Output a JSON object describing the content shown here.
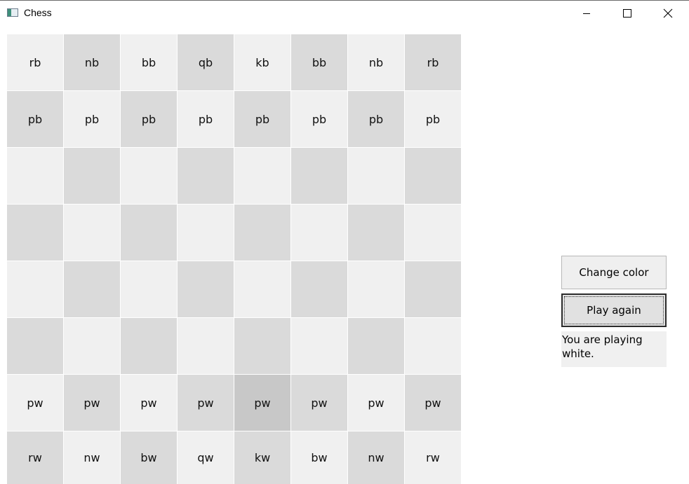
{
  "window": {
    "title": "Chess",
    "icon": "window-app-icon",
    "controls": [
      "minimize-icon",
      "maximize-icon",
      "close-icon"
    ]
  },
  "board": {
    "rows": [
      [
        "rb",
        "nb",
        "bb",
        "qb",
        "kb",
        "bb",
        "nb",
        "rb"
      ],
      [
        "pb",
        "pb",
        "pb",
        "pb",
        "pb",
        "pb",
        "pb",
        "pb"
      ],
      [
        "",
        "",
        "",
        "",
        "",
        "",
        "",
        ""
      ],
      [
        "",
        "",
        "",
        "",
        "",
        "",
        "",
        ""
      ],
      [
        "",
        "",
        "",
        "",
        "",
        "",
        "",
        ""
      ],
      [
        "",
        "",
        "",
        "",
        "",
        "",
        "",
        ""
      ],
      [
        "pw",
        "pw",
        "pw",
        "pw",
        "pw",
        "pw",
        "pw",
        "pw"
      ],
      [
        "rw",
        "nw",
        "bw",
        "qw",
        "kw",
        "bw",
        "nw",
        "rw"
      ]
    ],
    "selected_square": {
      "row": 6,
      "col": 4
    },
    "colors": {
      "light": "#f0f0f0",
      "dark": "#dadada",
      "selected": "#c8c8c8"
    }
  },
  "controls": {
    "change_color_label": "Change color",
    "play_again_label": "Play again",
    "status_text": "You are playing white."
  }
}
